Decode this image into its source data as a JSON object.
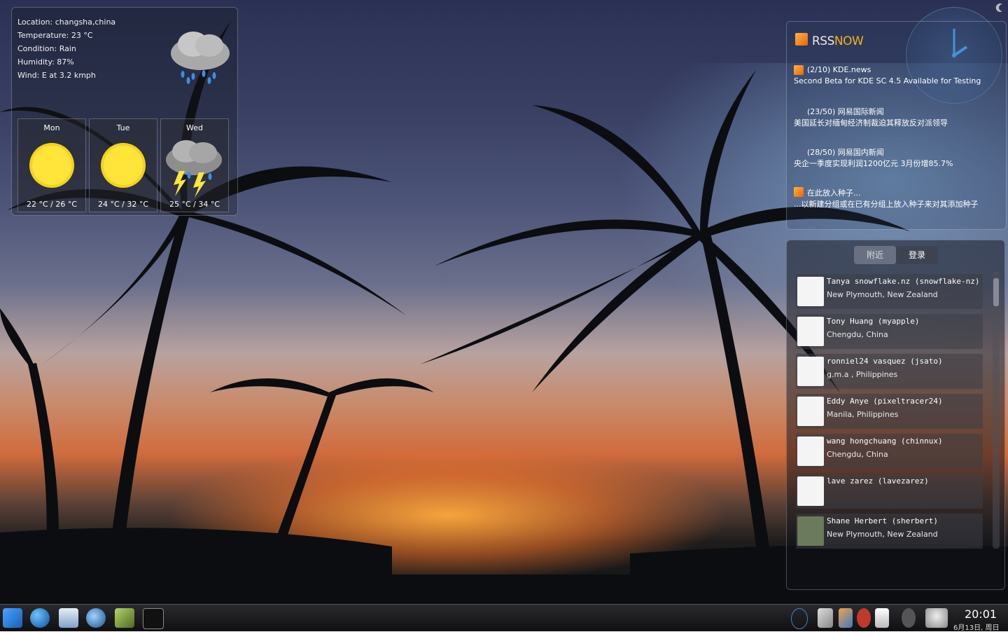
{
  "weather": {
    "location": "Location: changsha,china",
    "temperature": "Temperature: 23 °C",
    "condition": "Condition: Rain",
    "humidity": "Humidity: 87%",
    "wind": "Wind: E at 3.2 kmph",
    "current_icon": "rain-cloud-icon",
    "forecast": [
      {
        "day": "Mon",
        "temps": "22 °C / 26 °C",
        "icon": "sun-icon"
      },
      {
        "day": "Tue",
        "temps": "24 °C / 32 °C",
        "icon": "sun-icon"
      },
      {
        "day": "Wed",
        "temps": "25 °C / 34 °C",
        "icon": "thunderstorm-icon"
      }
    ]
  },
  "rss": {
    "title_a": "RSS",
    "title_b": "NOW",
    "items": [
      {
        "head": "(2/10) KDE.news",
        "sub": "Second Beta for KDE SC 4.5 Available for Testing"
      },
      {
        "head": "(23/50) 网易国际新闻",
        "sub": "美国延长对缅甸经济制裁迫其释放反对派领导"
      },
      {
        "head": "(28/50) 网易国内新闻",
        "sub": "央企一季度实现利润1200亿元 3月份增85.7%"
      },
      {
        "head": "在此放入种子...",
        "sub": "...以新建分组或在已有分组上放入种子来对其添加种子"
      }
    ]
  },
  "social": {
    "tabs": [
      "附近",
      "登录"
    ],
    "people": [
      {
        "name": "Tanya snowflake.nz (snowflake-nz)",
        "location": "New Plymouth, New Zealand"
      },
      {
        "name": "Tony Huang (myapple)",
        "location": "Chengdu, China"
      },
      {
        "name": "ronniel24 vasquez (jsato)",
        "location": "g.m.a , Philippines"
      },
      {
        "name": "Eddy Anye (pixeltracer24)",
        "location": "Manila, Philippines"
      },
      {
        "name": "wang hongchuang (chinnux)",
        "location": "Chengdu, China"
      },
      {
        "name": "lave zarez (lavezarez)",
        "location": ""
      },
      {
        "name": "Shane Herbert (sherbert)",
        "location": "New Plymouth, New Zealand"
      }
    ]
  },
  "taskbar": {
    "time": "20:01",
    "date": "6月13日, 周日"
  },
  "colors": {
    "rss_accent": "#f6b21a",
    "panel_border": "#ffffff40"
  }
}
